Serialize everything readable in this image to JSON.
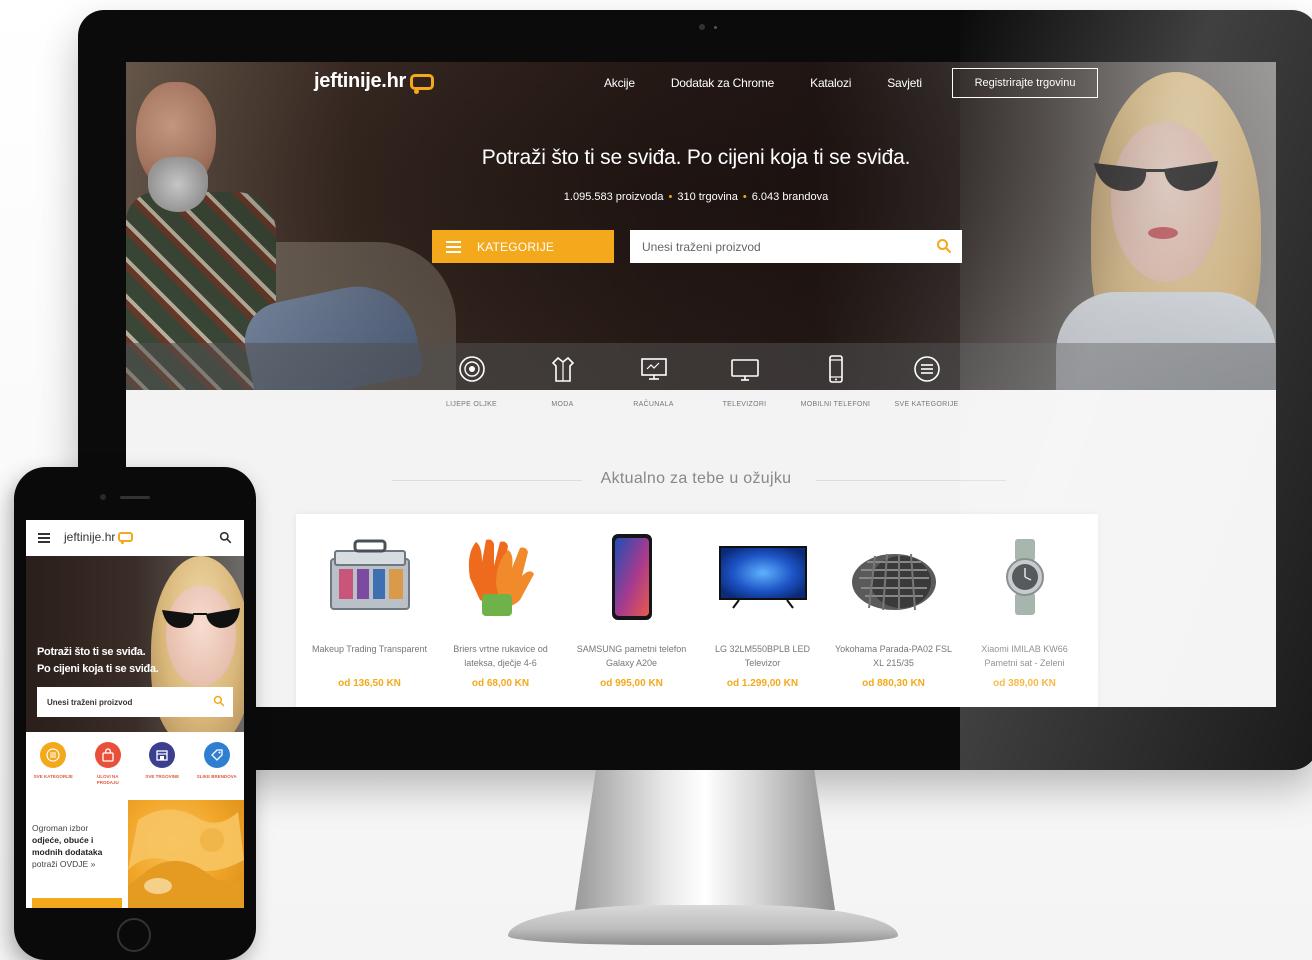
{
  "site": {
    "logo_text": "jeftinije.hr",
    "nav": [
      "Akcije",
      "Dodatak za Chrome",
      "Katalozi",
      "Savjeti"
    ],
    "register_label": "Registrirajte trgovinu",
    "headline": "Potraži što ti se sviđa. Po cijeni koja ti se sviđa.",
    "stats": {
      "products": "1.095.583 proizvoda",
      "stores": "310 trgovina",
      "brands": "6.043 brandova"
    },
    "categories_button": "KATEGORIJE",
    "search_placeholder": "Unesi traženi proizvod",
    "category_items": [
      {
        "label": "LIJEPE OLJKE",
        "icon": "perfume-icon"
      },
      {
        "label": "MODA",
        "icon": "shirt-icon"
      },
      {
        "label": "RAČUNALA",
        "icon": "computer-icon"
      },
      {
        "label": "TELEVIZORI",
        "icon": "tv-icon"
      },
      {
        "label": "MOBILNI TELEFONI",
        "icon": "phone-icon"
      },
      {
        "label": "SVE KATEGORIJE",
        "icon": "list-icon"
      }
    ],
    "section_title": "Aktualno za tebe u ožujku",
    "products": [
      {
        "name": "Makeup Trading Transparent",
        "price": "od 136,50 KN",
        "icon": "makeup-case-icon"
      },
      {
        "name": "Briers vrtne rukavice od lateksa, dječje 4-6",
        "price": "od 68,00 KN",
        "icon": "gloves-icon"
      },
      {
        "name": "SAMSUNG pametni telefon Galaxy A20e",
        "price": "od 995,00 KN",
        "icon": "smartphone-icon"
      },
      {
        "name": "LG 32LM550BPLB LED Televizor",
        "price": "od 1.299,00 KN",
        "icon": "television-icon"
      },
      {
        "name": "Yokohama Parada-PA02 FSL XL 215/35",
        "price": "od 880,30 KN",
        "icon": "tire-icon"
      },
      {
        "name": "Xiaomi IMILAB KW66 Pametni sat - Zeleni",
        "price": "od 389,00 KN",
        "icon": "smartwatch-icon"
      }
    ]
  },
  "mobile": {
    "logo_text": "jeftinije.hr",
    "headline_line1": "Potraži što ti se sviđa.",
    "headline_line2": "Po cijeni koja ti se sviđa.",
    "search_placeholder": "Unesi traženi proizvod",
    "categories": [
      {
        "label": "SVE KATEGORIJE",
        "color": "#f4a81c"
      },
      {
        "label": "ULOVI NA PRODAJU",
        "color": "#e8503a"
      },
      {
        "label": "SVE TRGOVINE",
        "color": "#3b3f8f"
      },
      {
        "label": "SLIKE BRENDOVA",
        "color": "#2f7fd1"
      }
    ],
    "promo_line1": "Ogroman izbor",
    "promo_bold1": "odjeće, obuće i",
    "promo_bold2": "modnih dodataka",
    "promo_line2": "potraži OVDJE »"
  },
  "colors": {
    "accent": "#f4a81c",
    "text_dark": "#333333",
    "muted": "#888888"
  }
}
